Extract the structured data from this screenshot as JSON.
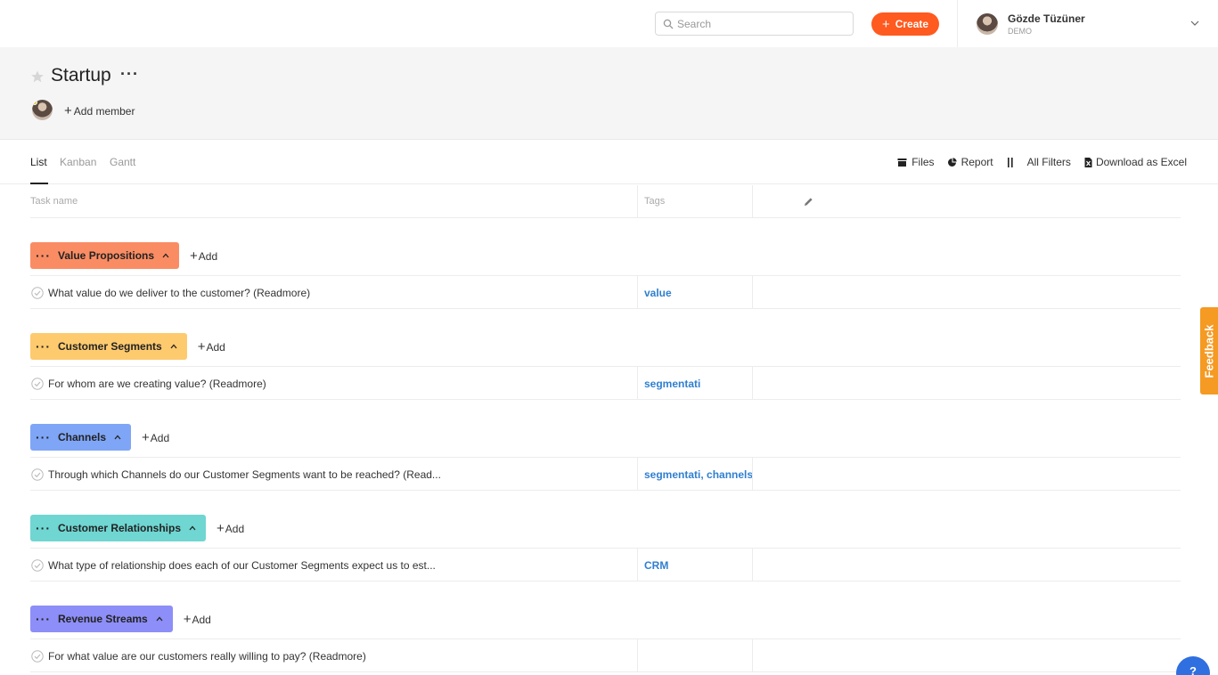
{
  "topbar": {
    "search_placeholder": "Search",
    "create_label": "Create",
    "user_name": "Gözde Tüzüner",
    "user_org": "DEMO"
  },
  "project": {
    "title": "Startup",
    "more": "···",
    "add_member_label": "Add member"
  },
  "views": {
    "tabs": [
      "List",
      "Kanban",
      "Gantt"
    ],
    "active": "List"
  },
  "toolbar": {
    "files": "Files",
    "report": "Report",
    "filters": "All Filters",
    "download": "Download as Excel"
  },
  "table": {
    "col_task": "Task name",
    "col_tags": "Tags"
  },
  "groups": [
    {
      "name": "Value Propositions",
      "color": "#fa8c64",
      "add": "Add",
      "tasks": [
        {
          "title": "What value do we deliver to the customer? (Readmore)",
          "tags": "value"
        }
      ]
    },
    {
      "name": "Customer Segments",
      "color": "#fdca6e",
      "add": "Add",
      "tasks": [
        {
          "title": "For whom are we creating value? (Readmore)",
          "tags": "segmentati"
        }
      ]
    },
    {
      "name": "Channels",
      "color": "#7fa5f6",
      "add": "Add",
      "tasks": [
        {
          "title": "Through which Channels do our Customer Segments want to be reached? (Read...",
          "tags": "segmentati, channels"
        }
      ]
    },
    {
      "name": "Customer Relationships",
      "color": "#6fd6d2",
      "add": "Add",
      "tasks": [
        {
          "title": "What type of relationship does each of our Customer Segments expect us to est...",
          "tags": "CRM"
        }
      ]
    },
    {
      "name": "Revenue Streams",
      "color": "#8d8ef7",
      "add": "Add",
      "tasks": [
        {
          "title": "For what value are our customers really willing to pay? (Readmore)",
          "tags": ""
        }
      ]
    }
  ],
  "feedback_label": "Feedback",
  "help_label": "?"
}
